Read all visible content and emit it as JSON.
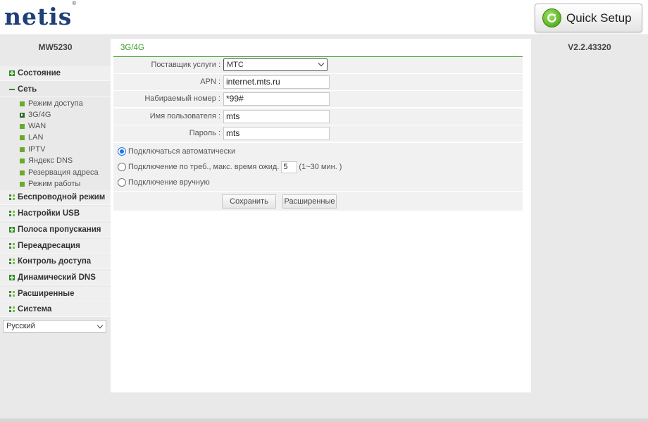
{
  "header": {
    "logo": "netis",
    "logo_mark": "®",
    "quick_setup_label": "Quick Setup",
    "quick_setup_icon": "refresh-arrow-icon"
  },
  "sidebar": {
    "model": "MW5230",
    "menu": [
      {
        "label": "Состояние",
        "icon": "plus-icon"
      },
      {
        "label": "Сеть",
        "icon": "minus-icon",
        "expanded": true
      },
      {
        "label": "Беспроводной режим",
        "icon": "grid-icon"
      },
      {
        "label": "Настройки USB",
        "icon": "grid-icon"
      },
      {
        "label": "Полоса пропускания",
        "icon": "plus-icon"
      },
      {
        "label": "Переадресация",
        "icon": "grid-icon"
      },
      {
        "label": "Контроль доступа",
        "icon": "grid-icon"
      },
      {
        "label": "Динамический DNS",
        "icon": "plus-icon"
      },
      {
        "label": "Расширенные",
        "icon": "grid-icon"
      },
      {
        "label": "Система",
        "icon": "grid-icon"
      }
    ],
    "network_submenu": [
      {
        "label": "Режим доступа",
        "active": false
      },
      {
        "label": "3G/4G",
        "active": true
      },
      {
        "label": "WAN",
        "active": false
      },
      {
        "label": "LAN",
        "active": false
      },
      {
        "label": "IPTV",
        "active": false
      },
      {
        "label": "Яндекс DNS",
        "active": false
      },
      {
        "label": "Резервация адреса",
        "active": false
      },
      {
        "label": "Режим работы",
        "active": false
      }
    ],
    "language": "Русский"
  },
  "main": {
    "title": "3G/4G",
    "provider": {
      "label": "Поставщик услуги :",
      "value": "MTC"
    },
    "fields": [
      {
        "label": "APN :",
        "value": "internet.mts.ru"
      },
      {
        "label": "Набираемый номер :",
        "value": "*99#"
      },
      {
        "label": "Имя пользователя :",
        "value": "mts"
      },
      {
        "label": "Пароль :",
        "value": "mts"
      }
    ],
    "connection_modes": {
      "auto": "Подключаться автоматически",
      "on_demand_prefix": "Подключение по треб., макс. время ожид.",
      "on_demand_value": "5",
      "on_demand_suffix": "(1~30 мин. )",
      "manual": "Подключение вручную",
      "selected": "auto"
    },
    "buttons": {
      "save": "Сохранить",
      "advanced": "Расширенные"
    }
  },
  "version": "V2.2.43320",
  "colors": {
    "brand_blue": "#1e3f78",
    "accent_green": "#3a9a27",
    "radio_blue": "#1a73e8"
  }
}
